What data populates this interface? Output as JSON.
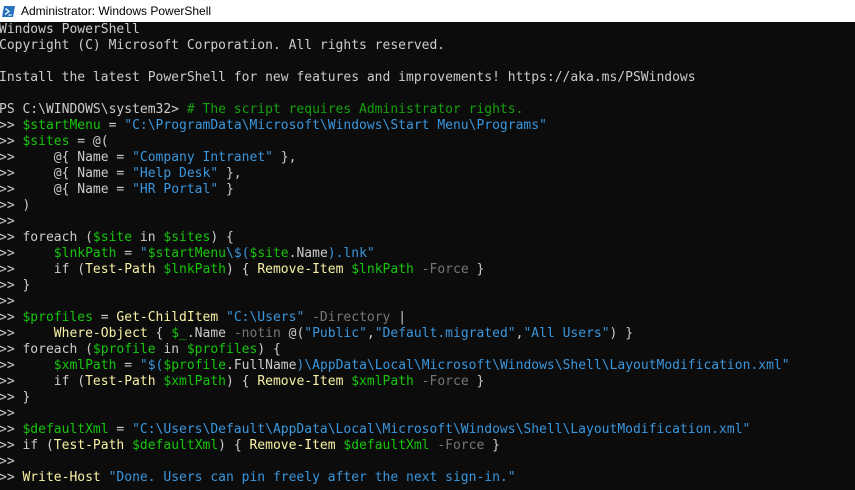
{
  "window": {
    "title": "Administrator: Windows PowerShell",
    "icon": "powershell-icon",
    "colors": {
      "background": "#0c0c0c",
      "foreground": "#cccccc",
      "variable": "#16c60c",
      "string": "#3a96dd",
      "comment": "#13a10e",
      "command": "#f9f1a5",
      "parameter": "#767676"
    }
  },
  "terminal": {
    "lines": [
      [
        {
          "t": "Windows PowerShell",
          "c": "def"
        }
      ],
      [
        {
          "t": "Copyright (C) Microsoft Corporation. All rights reserved.",
          "c": "def"
        }
      ],
      [],
      [
        {
          "t": "Install the latest PowerShell for new features and improvements! https://aka.ms/PSWindows",
          "c": "def"
        }
      ],
      [],
      [
        {
          "t": "PS C:\\WINDOWS\\system32> ",
          "c": "def"
        },
        {
          "t": "# The script requires Administrator rights.",
          "c": "cmt"
        }
      ],
      [
        {
          "t": ">> ",
          "c": "def"
        },
        {
          "t": "$startMenu",
          "c": "var"
        },
        {
          "t": " = ",
          "c": "def"
        },
        {
          "t": "\"C:\\ProgramData\\Microsoft\\Windows\\Start Menu\\Programs\"",
          "c": "str"
        }
      ],
      [
        {
          "t": ">> ",
          "c": "def"
        },
        {
          "t": "$sites",
          "c": "var"
        },
        {
          "t": " = @(",
          "c": "def"
        }
      ],
      [
        {
          "t": ">>     @{ Name = ",
          "c": "def"
        },
        {
          "t": "\"Company Intranet\"",
          "c": "str"
        },
        {
          "t": " },",
          "c": "def"
        }
      ],
      [
        {
          "t": ">>     @{ Name = ",
          "c": "def"
        },
        {
          "t": "\"Help Desk\"",
          "c": "str"
        },
        {
          "t": " },",
          "c": "def"
        }
      ],
      [
        {
          "t": ">>     @{ Name = ",
          "c": "def"
        },
        {
          "t": "\"HR Portal\"",
          "c": "str"
        },
        {
          "t": " }",
          "c": "def"
        }
      ],
      [
        {
          "t": ">> )",
          "c": "def"
        }
      ],
      [
        {
          "t": ">>",
          "c": "def"
        }
      ],
      [
        {
          "t": ">> foreach (",
          "c": "def"
        },
        {
          "t": "$site",
          "c": "var"
        },
        {
          "t": " in ",
          "c": "def"
        },
        {
          "t": "$sites",
          "c": "var"
        },
        {
          "t": ") {",
          "c": "def"
        }
      ],
      [
        {
          "t": ">>     ",
          "c": "def"
        },
        {
          "t": "$lnkPath",
          "c": "var"
        },
        {
          "t": " = ",
          "c": "def"
        },
        {
          "t": "\"",
          "c": "str"
        },
        {
          "t": "$startMenu",
          "c": "var"
        },
        {
          "t": "\\$(",
          "c": "str"
        },
        {
          "t": "$site",
          "c": "var"
        },
        {
          "t": ".Name",
          "c": "def"
        },
        {
          "t": ").lnk\"",
          "c": "str"
        }
      ],
      [
        {
          "t": ">>     if (",
          "c": "def"
        },
        {
          "t": "Test-Path",
          "c": "cmd"
        },
        {
          "t": " ",
          "c": "def"
        },
        {
          "t": "$lnkPath",
          "c": "var"
        },
        {
          "t": ") { ",
          "c": "def"
        },
        {
          "t": "Remove-Item",
          "c": "cmd"
        },
        {
          "t": " ",
          "c": "def"
        },
        {
          "t": "$lnkPath",
          "c": "var"
        },
        {
          "t": " ",
          "c": "def"
        },
        {
          "t": "-Force",
          "c": "param"
        },
        {
          "t": " }",
          "c": "def"
        }
      ],
      [
        {
          "t": ">> }",
          "c": "def"
        }
      ],
      [
        {
          "t": ">>",
          "c": "def"
        }
      ],
      [
        {
          "t": ">> ",
          "c": "def"
        },
        {
          "t": "$profiles",
          "c": "var"
        },
        {
          "t": " = ",
          "c": "def"
        },
        {
          "t": "Get-ChildItem",
          "c": "cmd"
        },
        {
          "t": " ",
          "c": "def"
        },
        {
          "t": "\"C:\\Users\"",
          "c": "str"
        },
        {
          "t": " ",
          "c": "def"
        },
        {
          "t": "-Directory",
          "c": "param"
        },
        {
          "t": " |",
          "c": "def"
        }
      ],
      [
        {
          "t": ">>     ",
          "c": "def"
        },
        {
          "t": "Where-Object",
          "c": "cmd"
        },
        {
          "t": " { ",
          "c": "def"
        },
        {
          "t": "$_",
          "c": "var"
        },
        {
          "t": ".Name ",
          "c": "def"
        },
        {
          "t": "-notin",
          "c": "param"
        },
        {
          "t": " @(",
          "c": "def"
        },
        {
          "t": "\"Public\"",
          "c": "str"
        },
        {
          "t": ",",
          "c": "def"
        },
        {
          "t": "\"Default.migrated\"",
          "c": "str"
        },
        {
          "t": ",",
          "c": "def"
        },
        {
          "t": "\"All Users\"",
          "c": "str"
        },
        {
          "t": ") }",
          "c": "def"
        }
      ],
      [
        {
          "t": ">> foreach (",
          "c": "def"
        },
        {
          "t": "$profile",
          "c": "var"
        },
        {
          "t": " in ",
          "c": "def"
        },
        {
          "t": "$profiles",
          "c": "var"
        },
        {
          "t": ") {",
          "c": "def"
        }
      ],
      [
        {
          "t": ">>     ",
          "c": "def"
        },
        {
          "t": "$xmlPath",
          "c": "var"
        },
        {
          "t": " = ",
          "c": "def"
        },
        {
          "t": "\"$(",
          "c": "str"
        },
        {
          "t": "$profile",
          "c": "var"
        },
        {
          "t": ".FullName",
          "c": "def"
        },
        {
          "t": ")\\AppData\\Local\\Microsoft\\Windows\\Shell\\LayoutModification.xml\"",
          "c": "str"
        }
      ],
      [
        {
          "t": ">>     if (",
          "c": "def"
        },
        {
          "t": "Test-Path",
          "c": "cmd"
        },
        {
          "t": " ",
          "c": "def"
        },
        {
          "t": "$xmlPath",
          "c": "var"
        },
        {
          "t": ") { ",
          "c": "def"
        },
        {
          "t": "Remove-Item",
          "c": "cmd"
        },
        {
          "t": " ",
          "c": "def"
        },
        {
          "t": "$xmlPath",
          "c": "var"
        },
        {
          "t": " ",
          "c": "def"
        },
        {
          "t": "-Force",
          "c": "param"
        },
        {
          "t": " }",
          "c": "def"
        }
      ],
      [
        {
          "t": ">> }",
          "c": "def"
        }
      ],
      [
        {
          "t": ">>",
          "c": "def"
        }
      ],
      [
        {
          "t": ">> ",
          "c": "def"
        },
        {
          "t": "$defaultXml",
          "c": "var"
        },
        {
          "t": " = ",
          "c": "def"
        },
        {
          "t": "\"C:\\Users\\Default\\AppData\\Local\\Microsoft\\Windows\\Shell\\LayoutModification.xml\"",
          "c": "str"
        }
      ],
      [
        {
          "t": ">> if (",
          "c": "def"
        },
        {
          "t": "Test-Path",
          "c": "cmd"
        },
        {
          "t": " ",
          "c": "def"
        },
        {
          "t": "$defaultXml",
          "c": "var"
        },
        {
          "t": ") { ",
          "c": "def"
        },
        {
          "t": "Remove-Item",
          "c": "cmd"
        },
        {
          "t": " ",
          "c": "def"
        },
        {
          "t": "$defaultXml",
          "c": "var"
        },
        {
          "t": " ",
          "c": "def"
        },
        {
          "t": "-Force",
          "c": "param"
        },
        {
          "t": " }",
          "c": "def"
        }
      ],
      [
        {
          "t": ">>",
          "c": "def"
        }
      ],
      [
        {
          "t": ">> ",
          "c": "def"
        },
        {
          "t": "Write-Host",
          "c": "cmd"
        },
        {
          "t": " ",
          "c": "def"
        },
        {
          "t": "\"Done. Users can pin freely after the next sign-in.\"",
          "c": "str"
        }
      ]
    ]
  }
}
